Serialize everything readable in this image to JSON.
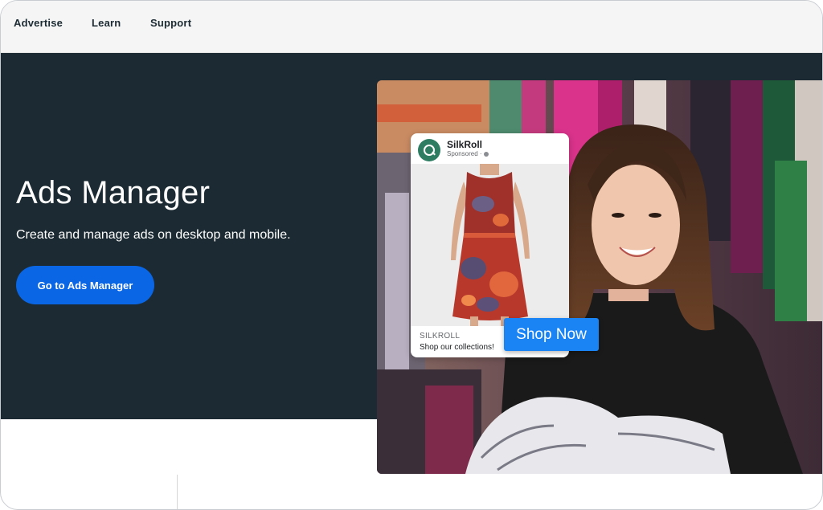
{
  "nav": {
    "items": [
      {
        "label": "Advertise"
      },
      {
        "label": "Learn"
      },
      {
        "label": "Support"
      }
    ]
  },
  "hero": {
    "title": "Ads Manager",
    "subtitle": "Create and manage ads on desktop and mobile.",
    "cta_label": "Go to Ads Manager"
  },
  "ad": {
    "brand": "SilkRoll",
    "sponsored": "Sponsored ·",
    "caption_brand": "SILKROLL",
    "caption_text": "Shop our collections!",
    "cta_label": "Shop Now"
  },
  "colors": {
    "hero_bg": "#1c2b33",
    "cta_blue": "#0a66e4",
    "shop_now_blue": "#1b84f5"
  }
}
